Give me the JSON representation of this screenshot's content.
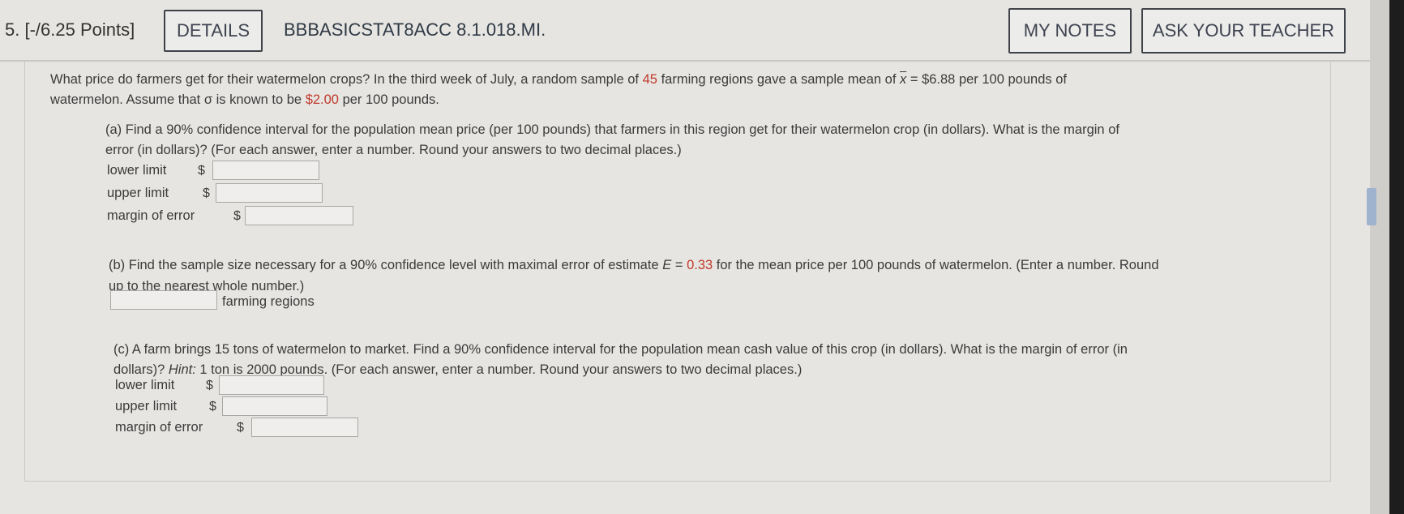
{
  "header": {
    "question_number": "5.",
    "points": "[-/6.25 Points]",
    "details_button": "DETAILS",
    "question_code": "BBBASICSTAT8ACC 8.1.018.MI.",
    "my_notes_button": "MY NOTES",
    "ask_teacher_button": "ASK YOUR TEACHER"
  },
  "intro": {
    "line1_a": "What price do farmers get for their watermelon crops? In the third week of July, a random sample of",
    "sample_size": "45",
    "line1_b": "farming regions gave a sample mean of",
    "xbar": "x",
    "line1_c": "= $6.88 per 100 pounds of",
    "line2_a": "watermelon. Assume that σ is known to be",
    "sigma": "$2.00",
    "line2_b": "per 100 pounds."
  },
  "part_a": {
    "line1": "(a) Find a 90% confidence interval for the population mean price (per 100 pounds) that farmers in this region get for their watermelon crop (in dollars). What is the margin of",
    "line2": "error (in dollars)? (For each answer, enter a number. Round your answers to two decimal places.)",
    "lower_label": "lower limit",
    "upper_label": "upper limit",
    "margin_label": "margin of error",
    "currency": "$",
    "lower_value": "",
    "upper_value": "",
    "margin_value": ""
  },
  "part_b": {
    "line1_a": "(b) Find the sample size necessary for a 90% confidence level with maximal error of estimate",
    "e_symbol": "E",
    "line1_eq": "=",
    "e_value": "0.33",
    "line1_b": "for the mean price per 100 pounds of watermelon. (Enter a number. Round",
    "line2": "up to the nearest whole number.)",
    "unit_label": "farming regions",
    "value": ""
  },
  "part_c": {
    "line1": "(c) A farm brings 15 tons of watermelon to market. Find a 90% confidence interval for the population mean cash value of this crop (in dollars). What is the margin of error (in",
    "line2_a": "dollars)?",
    "hint_label": "Hint:",
    "line2_b": "1 ton is 2000 pounds. (For each answer, enter a number. Round your answers to two decimal places.)",
    "lower_label": "lower limit",
    "upper_label": "upper limit",
    "margin_label": "margin of error",
    "currency": "$",
    "lower_value": "",
    "upper_value": "",
    "margin_value": ""
  }
}
